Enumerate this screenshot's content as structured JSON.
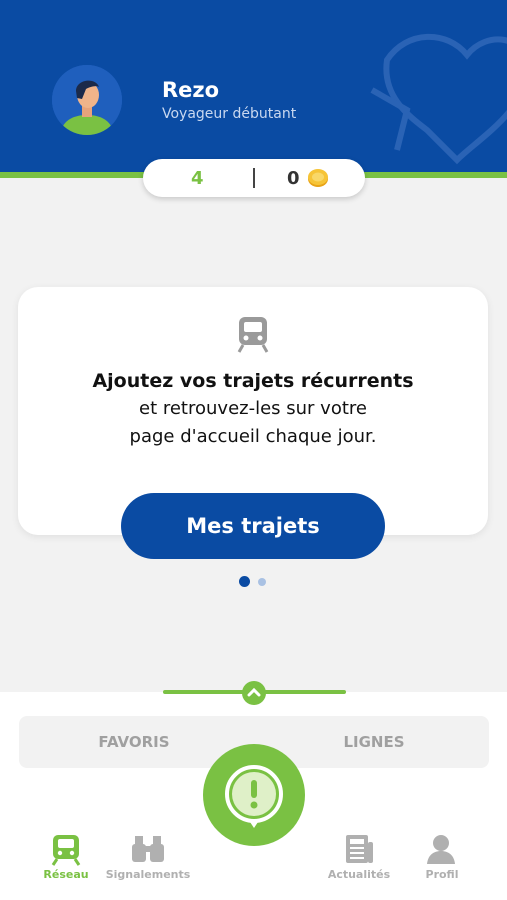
{
  "user": {
    "name": "Rezo",
    "level": "Voyageur débutant"
  },
  "stats": {
    "points": "4",
    "coins": "0"
  },
  "card": {
    "title": "Ajoutez vos trajets récurrents",
    "line1": "et retrouvez-les sur votre",
    "line2": "page d'accueil chaque jour.",
    "button_label": "Mes trajets",
    "icon": "train-icon"
  },
  "carousel": {
    "pages": 2,
    "active": 1
  },
  "segments": {
    "favoris": "FAVORIS",
    "lignes": "LIGNES"
  },
  "tabs": [
    {
      "label": "Réseau",
      "icon": "train-icon",
      "active": true
    },
    {
      "label": "Signalements",
      "icon": "binoculars-icon",
      "active": false
    },
    {
      "label": "Actualités",
      "icon": "newspaper-icon",
      "active": false
    },
    {
      "label": "Profil",
      "icon": "person-icon",
      "active": false
    }
  ],
  "fab": {
    "icon": "alert-icon"
  },
  "colors": {
    "primary_blue": "#0a4ba3",
    "accent_green": "#7ac143",
    "inactive_gray": "#b0b0b0"
  }
}
